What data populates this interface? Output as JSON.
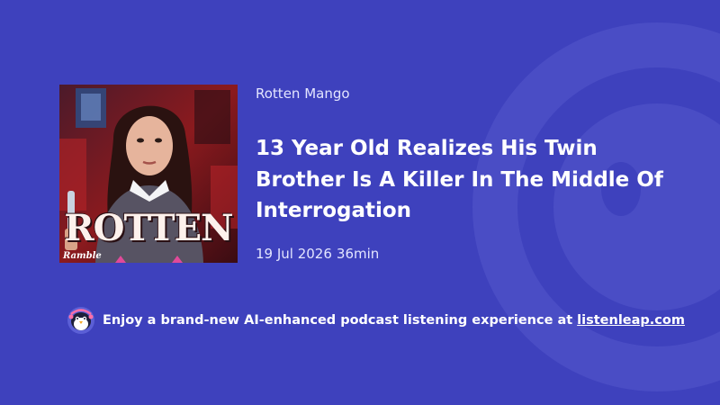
{
  "cover": {
    "title_text": "ROTTEN",
    "brand_text": "Ramble"
  },
  "podcast": {
    "show_name": "Rotten Mango",
    "episode_title": "13 Year Old Realizes His Twin Brother Is A Killer In The Middle Of Interrogation",
    "date": "19 Jul 2026",
    "duration": "36min"
  },
  "promo": {
    "text": "Enjoy a brand-new AI-enhanced podcast listening experience at",
    "link_text": "listenleap.com",
    "logo_icon": "penguin-logo-icon"
  },
  "colors": {
    "background": "#3e41bd",
    "text": "#ffffff",
    "muted_text": "#e3e5ff"
  }
}
